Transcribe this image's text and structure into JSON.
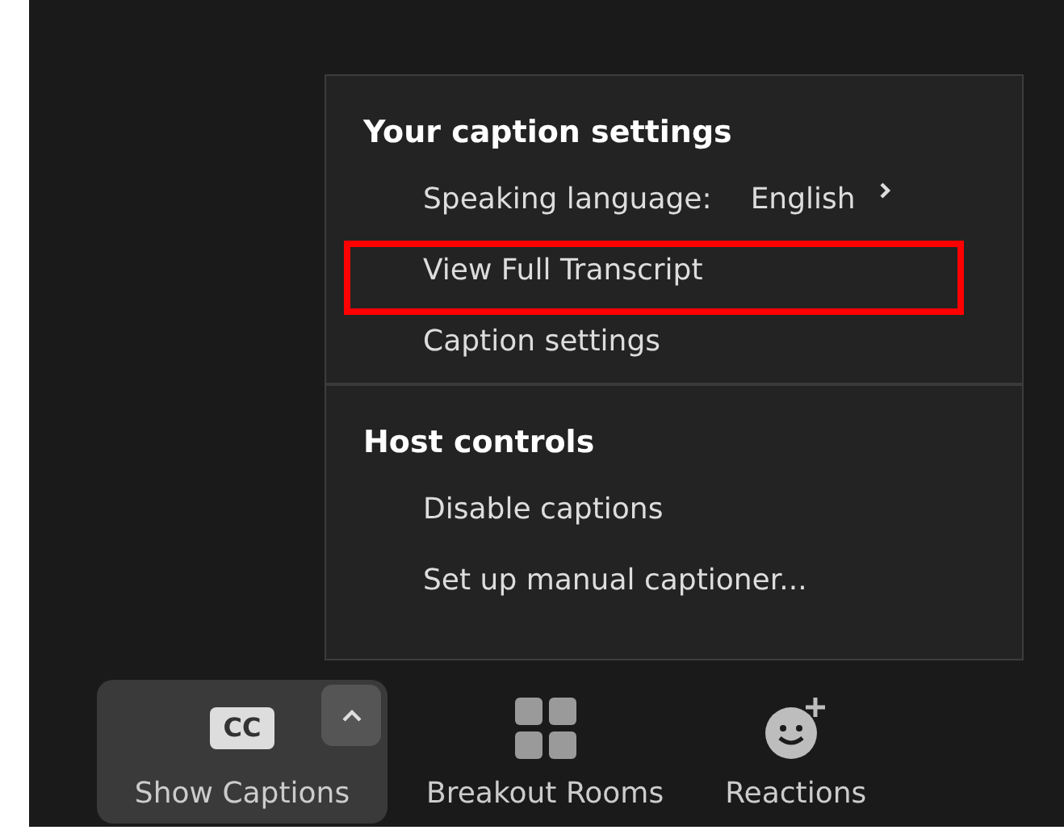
{
  "menu": {
    "sections": [
      {
        "title": "Your caption settings",
        "items": [
          {
            "kind": "submenu",
            "label": "Speaking language:",
            "value": "English",
            "highlighted": false
          },
          {
            "kind": "action",
            "label": "View Full Transcript",
            "highlighted": true
          },
          {
            "kind": "action",
            "label": "Caption settings",
            "highlighted": false
          }
        ]
      },
      {
        "title": "Host controls",
        "items": [
          {
            "kind": "action",
            "label": "Disable captions",
            "highlighted": false
          },
          {
            "kind": "action",
            "label": "Set up manual captioner...",
            "highlighted": false
          }
        ]
      }
    ]
  },
  "toolbar": [
    {
      "kind": "captions",
      "label": "Show Captions",
      "icon_text": "CC",
      "selected": true
    },
    {
      "kind": "breakout",
      "label": "Breakout Rooms",
      "selected": false
    },
    {
      "kind": "reactions",
      "label": "Reactions",
      "selected": false
    }
  ]
}
